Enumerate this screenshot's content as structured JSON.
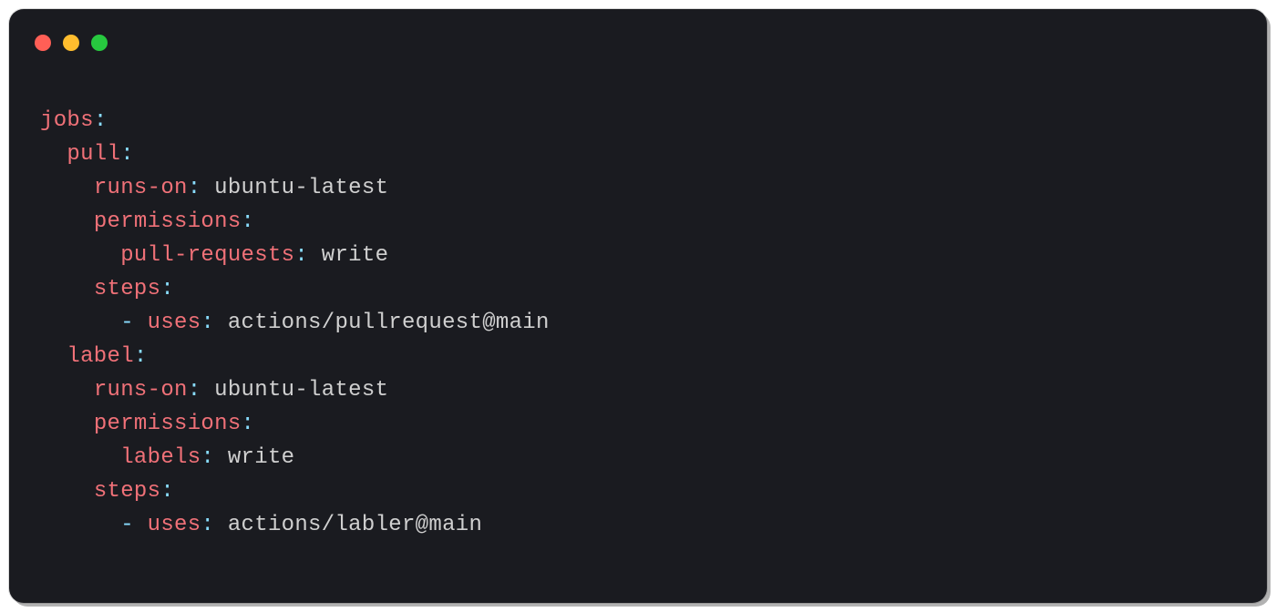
{
  "code": {
    "lines": [
      {
        "indent": 0,
        "key": "jobs",
        "value": ""
      },
      {
        "indent": 1,
        "key": "pull",
        "value": ""
      },
      {
        "indent": 2,
        "key": "runs-on",
        "value": "ubuntu-latest"
      },
      {
        "indent": 2,
        "key": "permissions",
        "value": ""
      },
      {
        "indent": 3,
        "key": "pull-requests",
        "value": "write"
      },
      {
        "indent": 2,
        "key": "steps",
        "value": ""
      },
      {
        "indent": 3,
        "dash": true,
        "key": "uses",
        "value": "actions/pullrequest@main"
      },
      {
        "indent": 1,
        "key": "label",
        "value": ""
      },
      {
        "indent": 2,
        "key": "runs-on",
        "value": "ubuntu-latest"
      },
      {
        "indent": 2,
        "key": "permissions",
        "value": ""
      },
      {
        "indent": 3,
        "key": "labels",
        "value": "write"
      },
      {
        "indent": 2,
        "key": "steps",
        "value": ""
      },
      {
        "indent": 3,
        "dash": true,
        "key": "uses",
        "value": "actions/labler@main"
      }
    ]
  },
  "colors": {
    "key": "#f07178",
    "punctuation": "#89ddff",
    "value": "#d0d0d0",
    "background": "#1a1b20"
  }
}
